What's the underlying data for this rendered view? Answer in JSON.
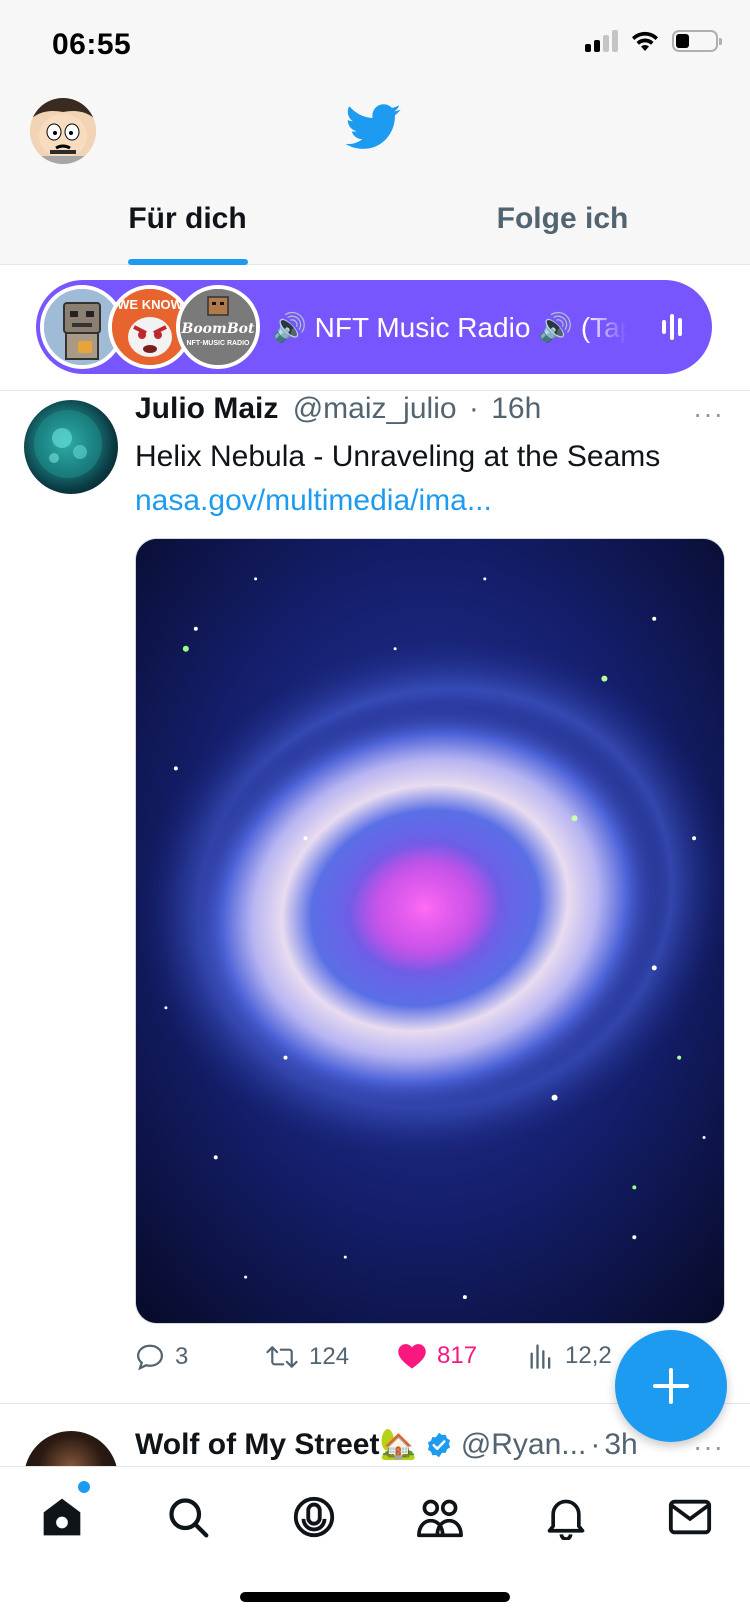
{
  "status_bar": {
    "time": "06:55",
    "battery_level": 0.35
  },
  "header": {
    "tabs": [
      {
        "label": "Für dich",
        "active": true
      },
      {
        "label": "Folge ich",
        "active": false
      }
    ]
  },
  "space": {
    "title": "🔊 NFT Music Radio 🔊 (Tap",
    "avatars": [
      "robot-avatar",
      "we-know-avatar",
      "boombot-avatar"
    ],
    "avatar_text": {
      "we_know": "WE KNOW",
      "boombot": "BoomBot",
      "boombot_sub": "NFT·MUSIC RADIO"
    }
  },
  "tweet": {
    "name": "Julio Maiz",
    "handle": "@maiz_julio",
    "time": "16h",
    "separator": "·",
    "text": "Helix Nebula - Unraveling at the Seams",
    "link": "nasa.gov/multimedia/ima...",
    "more": "···",
    "actions": {
      "replies": "3",
      "retweets": "124",
      "likes": "817",
      "views": "12,2"
    },
    "liked": true
  },
  "tweet2": {
    "name": "Wolf of My Street🏡",
    "handle": "@Ryan...",
    "separator": "·",
    "time": "3h",
    "more": "···"
  },
  "colors": {
    "accent": "#1d9bf0",
    "like": "#f91880",
    "space": "#7856ff",
    "text": "#0f1419",
    "muted": "#536471"
  },
  "icons": {
    "nav": [
      "home-icon",
      "search-icon",
      "spaces-icon",
      "communities-icon",
      "notifications-icon",
      "messages-icon"
    ],
    "fab": "compose-plus-icon"
  }
}
